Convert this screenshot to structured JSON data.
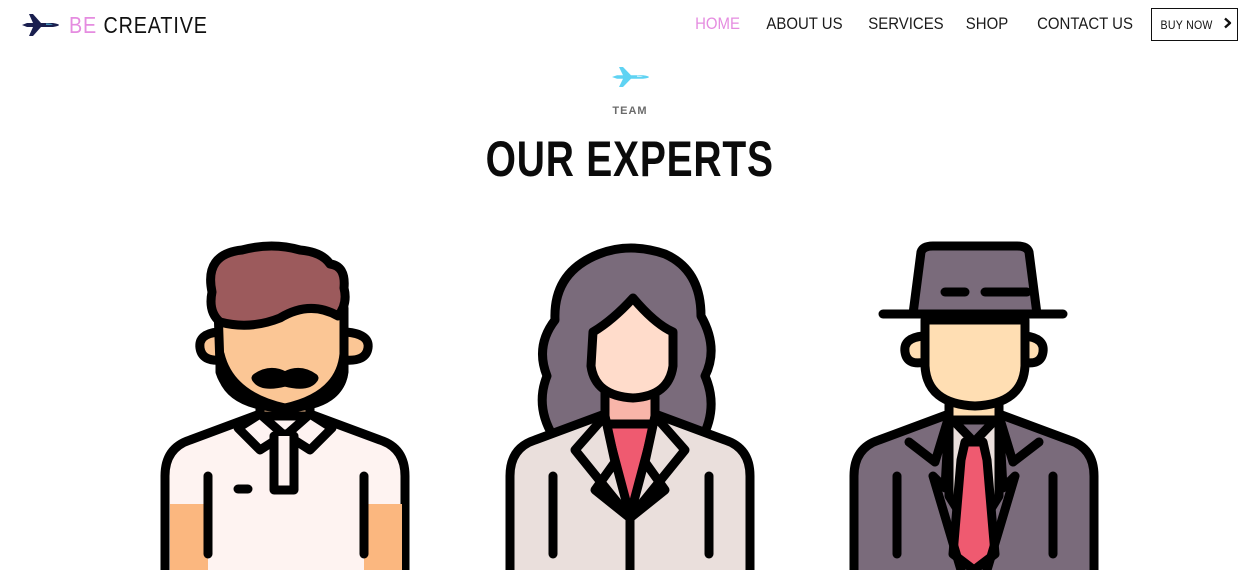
{
  "brand": {
    "accent": "BE",
    "name": "CREATIVE",
    "logo_icon": "plane-icon"
  },
  "nav": {
    "items": [
      {
        "label": "HOME",
        "active": true
      },
      {
        "label": "ABOUT US",
        "active": false
      },
      {
        "label": "SERVICES",
        "active": false
      },
      {
        "label": "SHOP",
        "active": false
      },
      {
        "label": "CONTACT US",
        "active": false
      }
    ],
    "buy_label": "BUY NOW",
    "buy_icon": "chevron-right-icon"
  },
  "section": {
    "icon": "plane-icon",
    "eyebrow": "TEAM",
    "title": "OUR EXPERTS"
  },
  "team": [
    {
      "icon": "bearded-man-avatar-icon"
    },
    {
      "icon": "woman-avatar-icon"
    },
    {
      "icon": "man-in-hat-avatar-icon"
    }
  ],
  "colors": {
    "accent": "#e58ce0",
    "text": "#111111",
    "plane_light": "#5fd3f3",
    "plane_dark": "#1a1f4f"
  }
}
